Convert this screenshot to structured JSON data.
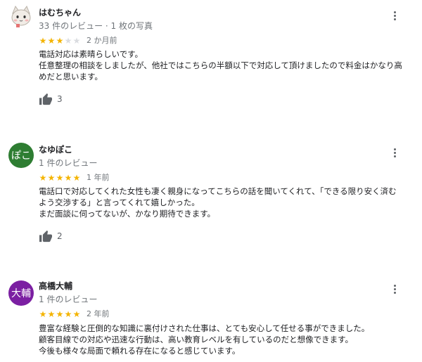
{
  "reviews": [
    {
      "author": "はむちゃん",
      "meta": "33 件のレビュー · 1 枚の写真",
      "rating": 3,
      "max_rating": 5,
      "time": "2 か月前",
      "lines": [
        "電話対応は素晴らしいです。",
        "任意整理の相談をしましたが、他社ではこちらの半額以下で対応して頂けましたので料金はかなり高",
        "めだと思います。"
      ],
      "likes": "3",
      "avatar_text": "",
      "avatar_color": "#ffffff"
    },
    {
      "author": "なゆぽこ",
      "meta": "1 件のレビュー",
      "rating": 5,
      "max_rating": 5,
      "time": "1 年前",
      "lines": [
        "電話口で対応してくれた女性も凄く親身になってこちらの話を聞いてくれて、「できる限り安く済む",
        "よう交渉する」と言ってくれて嬉しかった。",
        "まだ面談に伺ってないが、かなり期待できます。"
      ],
      "likes": "2",
      "avatar_text": "ぽこ",
      "avatar_color": "#2e7d32"
    },
    {
      "author": "高橋大輔",
      "meta": "1 件のレビュー",
      "rating": 5,
      "max_rating": 5,
      "time": "2 年前",
      "lines": [
        "豊富な経験と圧倒的な知識に裏付けされた仕事は、とても安心して任せる事ができました。",
        "顧客目線での対応や迅速な行動は、高い教育レベルを有しているのだと想像できます。",
        "今後も様々な局面で頼れる存在になると感じています。"
      ],
      "likes": "",
      "avatar_text": "大輔",
      "avatar_color": "#7b1fa2"
    }
  ],
  "colors": {
    "star_on": "#f4b400",
    "star_off": "#dadce0"
  },
  "icons": {
    "menu": "more-vert-icon",
    "like": "thumb-up-icon",
    "avatar1": "cat-avatar-icon"
  }
}
